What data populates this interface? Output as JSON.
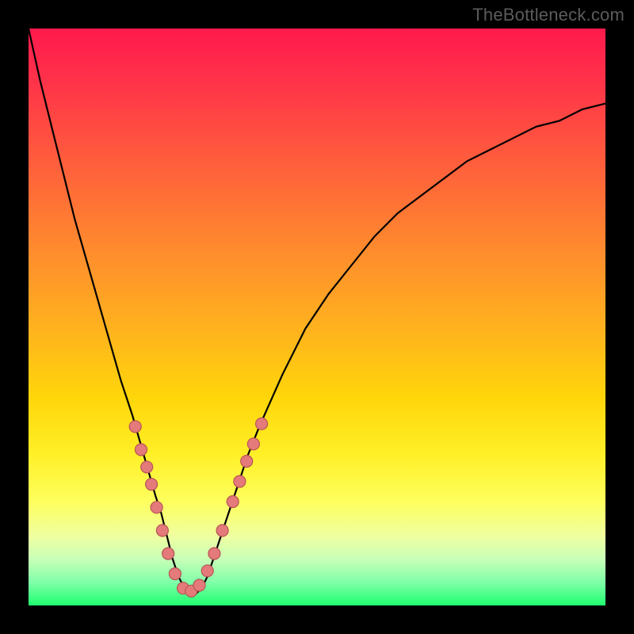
{
  "watermark": "TheBottleneck.com",
  "colors": {
    "frame": "#000000",
    "watermark": "#5b5b5b",
    "curve": "#000000",
    "dot_fill": "#e47a7a",
    "dot_stroke": "#b85454"
  },
  "chart_data": {
    "type": "line",
    "title": "",
    "xlabel": "",
    "ylabel": "",
    "xlim": [
      0,
      100
    ],
    "ylim": [
      0,
      100
    ],
    "grid": false,
    "legend": false,
    "gradient_stops": [
      {
        "pos": 0,
        "color": "#ff1a4d"
      },
      {
        "pos": 8,
        "color": "#ff2f4a"
      },
      {
        "pos": 22,
        "color": "#ff5a3d"
      },
      {
        "pos": 38,
        "color": "#ff8a2e"
      },
      {
        "pos": 52,
        "color": "#ffb21e"
      },
      {
        "pos": 64,
        "color": "#ffd60a"
      },
      {
        "pos": 74,
        "color": "#fff028"
      },
      {
        "pos": 82,
        "color": "#feff5e"
      },
      {
        "pos": 88,
        "color": "#efffa0"
      },
      {
        "pos": 92,
        "color": "#c8ffb8"
      },
      {
        "pos": 96,
        "color": "#7fffa8"
      },
      {
        "pos": 100,
        "color": "#1fff6e"
      }
    ],
    "series": [
      {
        "name": "bottleneck-curve",
        "annotation": "V-shaped curve; lower y = better (green); minimum near x≈27; axes unlabeled",
        "x": [
          0,
          2,
          4,
          6,
          8,
          10,
          12,
          14,
          16,
          18,
          20,
          22,
          23,
          24,
          25,
          26,
          27,
          28,
          29,
          30,
          31,
          32,
          34,
          36,
          38,
          40,
          44,
          48,
          52,
          56,
          60,
          64,
          68,
          72,
          76,
          80,
          84,
          88,
          92,
          96,
          100
        ],
        "y": [
          100,
          91,
          83,
          75,
          67,
          60,
          53,
          46,
          39,
          33,
          26,
          19,
          16,
          12,
          8,
          5,
          3,
          2,
          2,
          3,
          5,
          8,
          14,
          20,
          26,
          31,
          40,
          48,
          54,
          59,
          64,
          68,
          71,
          74,
          77,
          79,
          81,
          83,
          84,
          86,
          87
        ]
      }
    ],
    "markers": {
      "name": "sample-dots",
      "annotation": "salmon dots clustered along lower V portion",
      "points": [
        {
          "x": 18.5,
          "y": 31
        },
        {
          "x": 19.5,
          "y": 27
        },
        {
          "x": 20.5,
          "y": 24
        },
        {
          "x": 21.3,
          "y": 21
        },
        {
          "x": 22.2,
          "y": 17
        },
        {
          "x": 23.2,
          "y": 13
        },
        {
          "x": 24.2,
          "y": 9
        },
        {
          "x": 25.4,
          "y": 5.5
        },
        {
          "x": 26.8,
          "y": 3
        },
        {
          "x": 28.2,
          "y": 2.5
        },
        {
          "x": 29.6,
          "y": 3.5
        },
        {
          "x": 31.0,
          "y": 6
        },
        {
          "x": 32.2,
          "y": 9
        },
        {
          "x": 33.6,
          "y": 13
        },
        {
          "x": 35.4,
          "y": 18
        },
        {
          "x": 36.6,
          "y": 21.5
        },
        {
          "x": 37.8,
          "y": 25
        },
        {
          "x": 39.0,
          "y": 28
        },
        {
          "x": 40.4,
          "y": 31.5
        }
      ]
    }
  }
}
